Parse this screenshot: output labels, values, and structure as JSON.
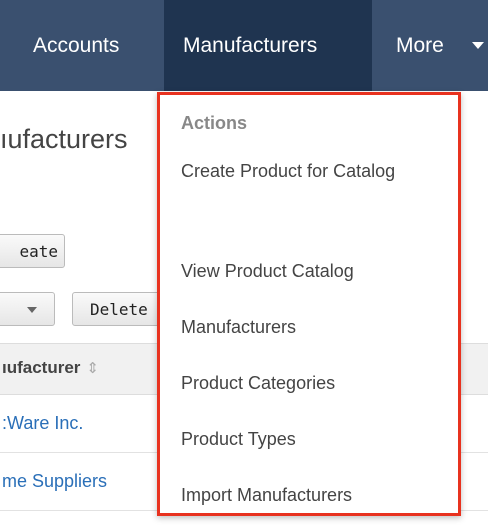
{
  "nav": {
    "items": [
      "Accounts",
      "Manufacturers",
      "More"
    ]
  },
  "page": {
    "title": "ıufacturers",
    "create_label": "eate",
    "delete_label": "Delete",
    "column_header": "ıufacturer",
    "rows": [
      ":Ware Inc.",
      "me Suppliers"
    ]
  },
  "menu": {
    "heading": "Actions",
    "items": [
      "Create Product for Catalog",
      "View Product Catalog",
      "Manufacturers",
      "Product Categories",
      "Product Types",
      "Import Manufacturers"
    ]
  },
  "colors": {
    "nav_bg": "#3a506f",
    "nav_active_bg": "#1f3450",
    "highlight_border": "#e8321f",
    "link": "#2a6fb8"
  }
}
